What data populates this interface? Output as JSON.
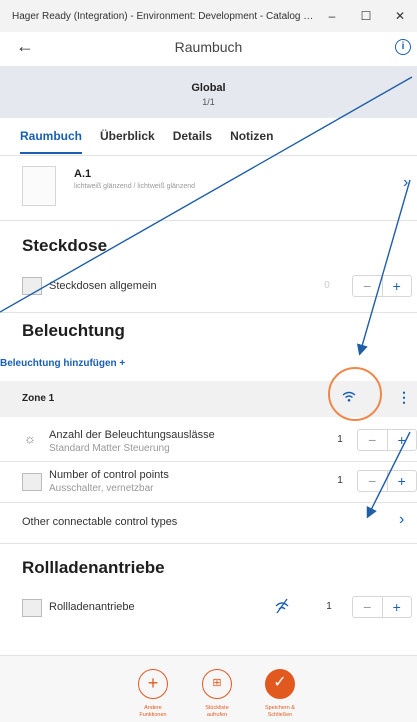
{
  "window": {
    "title": "Hager Ready (Integration) - Environment: Development - Catalog environment: Prod...",
    "minimize": "–",
    "maximize": "☐",
    "close": "✕"
  },
  "appbar": {
    "title": "Raumbuch",
    "back": "←",
    "info": "i"
  },
  "banner": {
    "title": "Global",
    "pages": "1/1"
  },
  "tabs": [
    {
      "label": "Raumbuch"
    },
    {
      "label": "Überblick"
    },
    {
      "label": "Details"
    },
    {
      "label": "Notizen"
    }
  ],
  "room": {
    "title": "A.1",
    "subtitle": "lichtweiß glänzend / lichtweiß glänzend"
  },
  "steckdose": {
    "heading": "Steckdose",
    "items": [
      {
        "label": "Steckdosen allgemein",
        "qty": "0"
      }
    ]
  },
  "beleuchtung": {
    "heading": "Beleuchtung",
    "add_link": "Beleuchtung hinzufügen +",
    "zone": {
      "title": "Zone 1"
    },
    "items": [
      {
        "label": "Anzahl der Beleuchtungsauslässe",
        "sub": "Standard Matter Steuerung",
        "qty": "1"
      },
      {
        "label": "Number of control points",
        "sub": "Ausschalter, vernetzbar",
        "qty": "1"
      }
    ],
    "other": "Other connectable control types"
  },
  "rollladen": {
    "heading": "Rollladenantriebe",
    "items": [
      {
        "label": "Rollladenantriebe",
        "qty": "1"
      }
    ]
  },
  "footer": {
    "buttons": [
      {
        "label": "Andere\nFunktionen"
      },
      {
        "label": "Stückliste\naufrufen"
      },
      {
        "label": "Speichern &\nSchließen"
      }
    ]
  },
  "colors": {
    "accent": "#1a5fb4",
    "orange": "#e2591f",
    "highlight": "#f1864a"
  }
}
